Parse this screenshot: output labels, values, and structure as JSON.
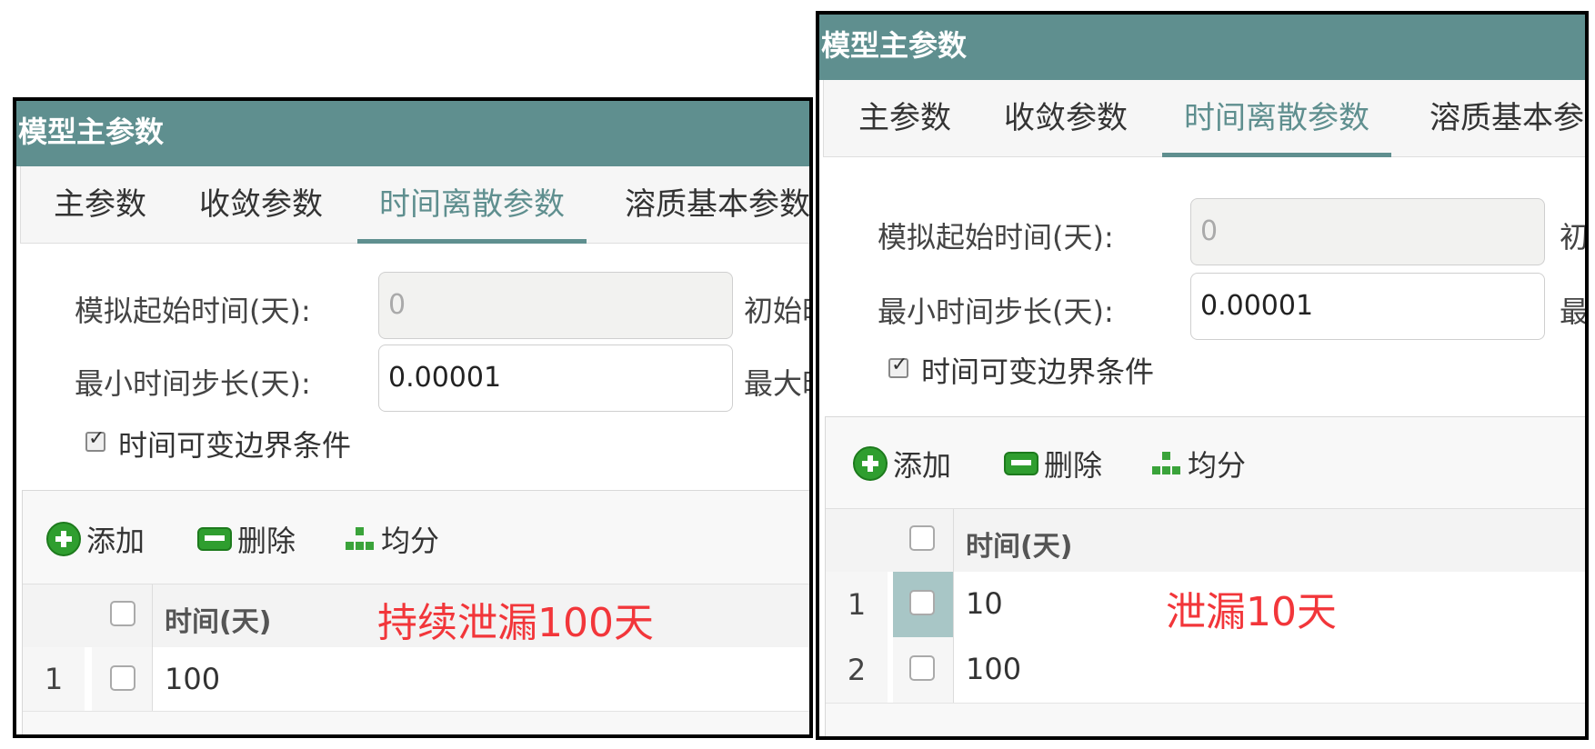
{
  "left_panel": {
    "title": "模型主参数",
    "tabs": [
      "主参数",
      "收敛参数",
      "时间离散参数",
      "溶质基本参数"
    ],
    "active_tab": 2,
    "fields": {
      "start_time_label": "模拟起始时间(天):",
      "start_time_value": "0",
      "min_step_label": "最小时间步长(天):",
      "min_step_value": "0.00001",
      "initial_label_clip": "初始时",
      "max_label_clip": "最大时"
    },
    "checkbox_label": "时间可变边界条件",
    "checkbox_checked": true,
    "toolbar": {
      "add": "添加",
      "delete": "删除",
      "split": "均分"
    },
    "column_header": "时间(天)",
    "rows": [
      {
        "num": "1",
        "value": "100"
      }
    ],
    "annotation": "持续泄漏100天"
  },
  "right_panel": {
    "title": "模型主参数",
    "tabs": [
      "主参数",
      "收敛参数",
      "时间离散参数",
      "溶质基本参"
    ],
    "active_tab": 2,
    "fields": {
      "start_time_label": "模拟起始时间(天):",
      "start_time_value": "0",
      "min_step_label": "最小时间步长(天):",
      "min_step_value": "0.00001",
      "initial_label_clip": "初",
      "max_label_clip": "最"
    },
    "checkbox_label": "时间可变边界条件",
    "checkbox_checked": true,
    "toolbar": {
      "add": "添加",
      "delete": "删除",
      "split": "均分"
    },
    "column_header": "时间(天)",
    "rows": [
      {
        "num": "1",
        "value": "10"
      },
      {
        "num": "2",
        "value": "100"
      }
    ],
    "annotation": "泄漏10天"
  },
  "colors": {
    "title_bar": "#5f8f8f",
    "active_tab": "#5f8f8f",
    "annotation": "#f2363a",
    "icon_green": "#2f9e2f",
    "row_selected": "#a8c6c6"
  }
}
